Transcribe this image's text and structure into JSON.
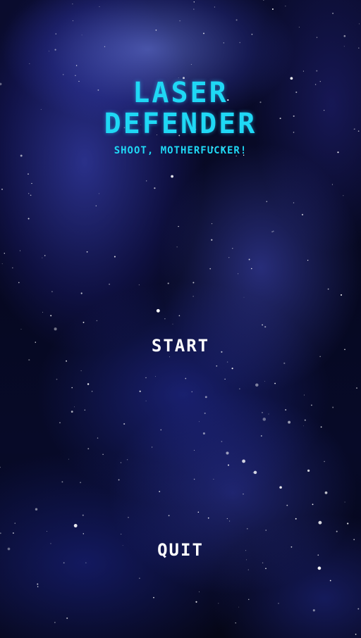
{
  "title": {
    "line1": "LASER",
    "line2": "DEFENDER"
  },
  "subtitle": "SHOOT, MOTHERFUCKER!",
  "menu": {
    "start_label": "START",
    "quit_label": "QUIT"
  },
  "colors": {
    "title": "#1fd8f5",
    "menu_text": "#ffffff",
    "background": "#060820"
  }
}
